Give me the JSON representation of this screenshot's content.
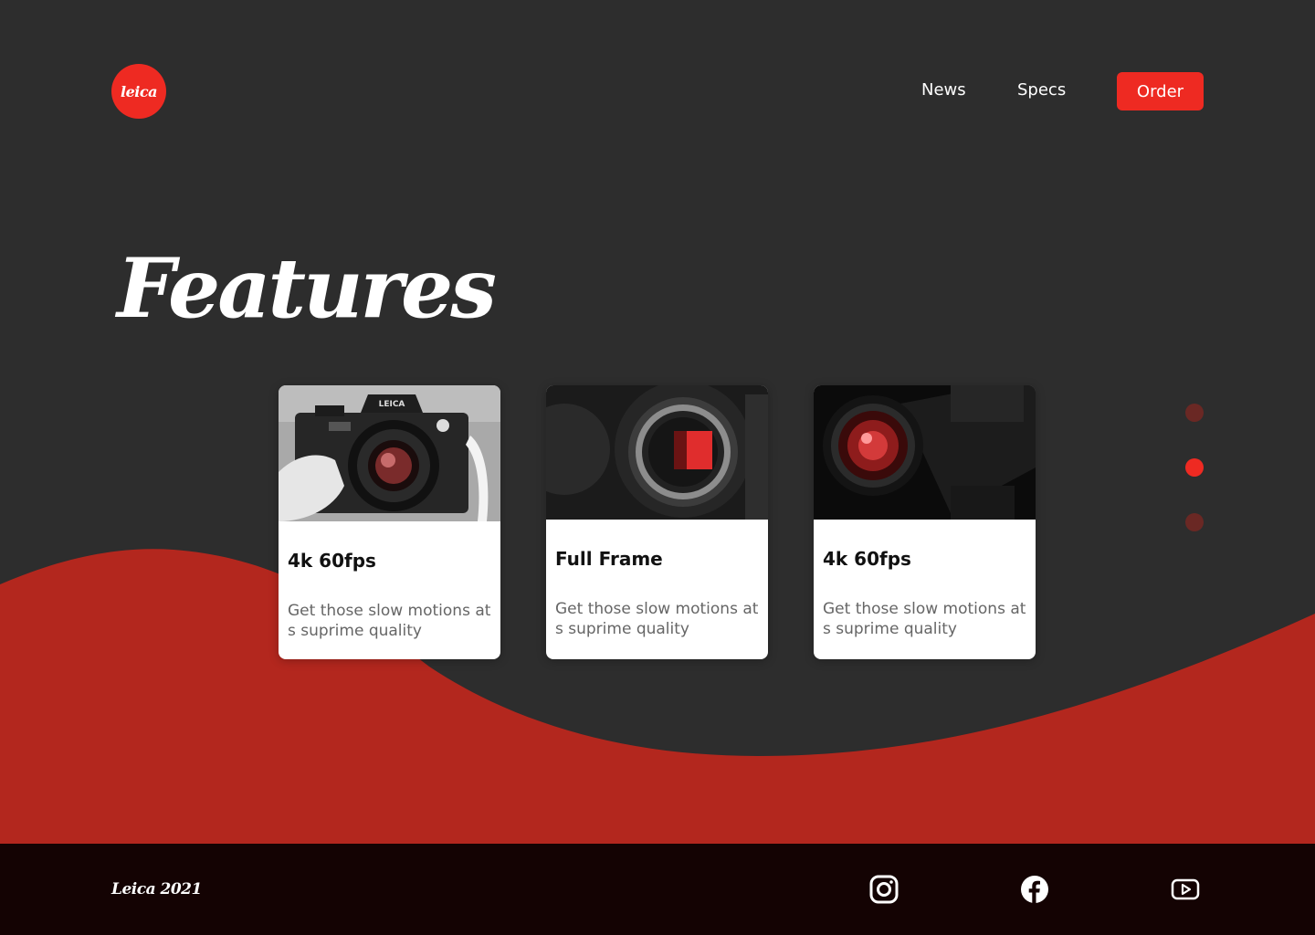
{
  "brand": {
    "logo_text": "leica"
  },
  "nav": {
    "news": "News",
    "specs": "Specs",
    "order": "Order"
  },
  "page": {
    "title": "Features"
  },
  "cards": [
    {
      "title": "4k 60fps",
      "description": "Get those slow motions at s suprime quality",
      "image": "leica-r7-camera-photo"
    },
    {
      "title": "Full Frame",
      "description": "Get those slow motions at s suprime quality",
      "image": "camera-sensor-mount-photo"
    },
    {
      "title": "4k 60fps",
      "description": "Get those slow motions at s suprime quality",
      "image": "camera-lens-photo"
    }
  ],
  "pagination": {
    "active_index": 1,
    "count": 3
  },
  "footer": {
    "copyright": "Leica 2021",
    "social": [
      "instagram-icon",
      "facebook-icon",
      "youtube-icon"
    ]
  },
  "colors": {
    "background": "#2d2d2d",
    "accent": "#ee2a22",
    "wave": "#b3271e",
    "footer": "#140303",
    "dot_inactive": "#6a2824"
  }
}
